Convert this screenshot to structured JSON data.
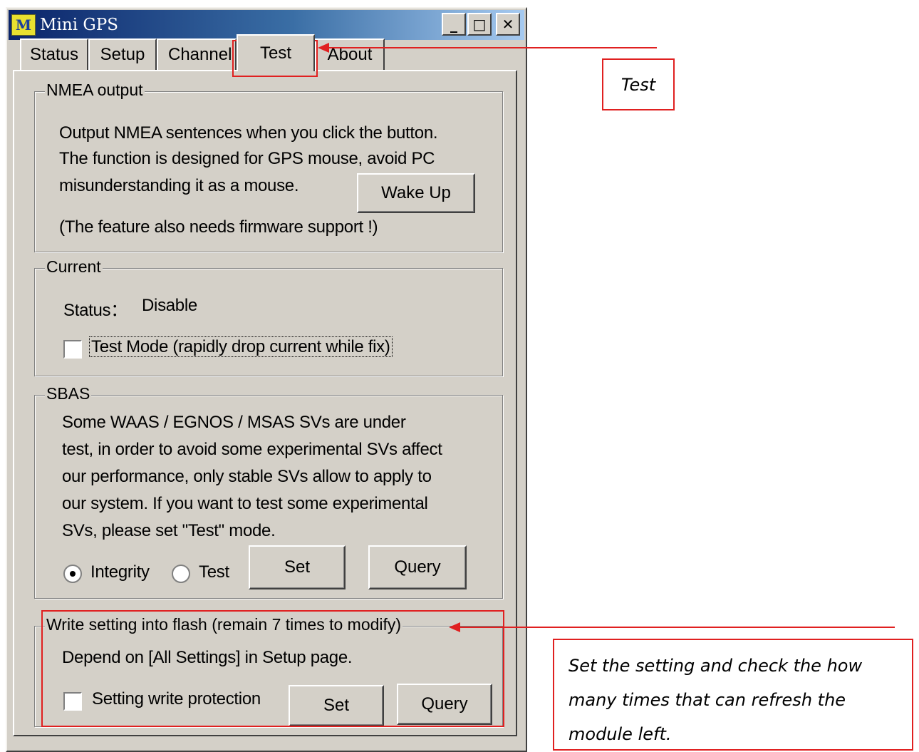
{
  "window": {
    "title": "Mini GPS",
    "icon": "app-logo-icon",
    "icon_glyph": "M",
    "controls": {
      "minimize": "_",
      "maximize": "□",
      "close": "✕"
    }
  },
  "tabs": [
    {
      "label": "Status",
      "active": false
    },
    {
      "label": "Setup",
      "active": false
    },
    {
      "label": "Channel",
      "active": false
    },
    {
      "label": "Test",
      "active": true
    },
    {
      "label": "About",
      "active": false
    }
  ],
  "nmea": {
    "legend": "NMEA output",
    "line1": "Output NMEA sentences when you click the button.",
    "line2": "The function is designed for GPS mouse, avoid PC",
    "line3": "misunderstanding it as a mouse.",
    "wake_button": "Wake Up",
    "note": "(The feature also needs firmware support !)"
  },
  "current": {
    "legend": "Current",
    "status_label": "Status：",
    "status_value": "Disable",
    "test_mode_label": "Test Mode (rapidly drop current while fix)",
    "test_mode_checked": false
  },
  "sbas": {
    "legend": "SBAS",
    "line1": "Some  WAAS / EGNOS / MSAS  SVs are under",
    "line2": "test, in order to avoid some experimental SVs affect",
    "line3": "our performance, only stable SVs allow to apply to",
    "line4": "our  system. If you want to test some experimental",
    "line5": "SVs, please set \"Test\" mode.",
    "radio_integrity": "Integrity",
    "radio_test": "Test",
    "selected": "Integrity",
    "set_button": "Set",
    "query_button": "Query"
  },
  "flash": {
    "legend": "Write setting into flash (remain  7  times to modify)",
    "depend_text": "Depend on [All Settings]  in  Setup page.",
    "protect_label": "Setting write protection",
    "protect_checked": false,
    "set_button": "Set",
    "query_button": "Query"
  },
  "annotations": {
    "test_callout": "Test",
    "flash_callout_line1": "Set the setting and check the how",
    "flash_callout_line2": "many times that can refresh the",
    "flash_callout_line3": "module left.",
    "color": "#e02020"
  }
}
